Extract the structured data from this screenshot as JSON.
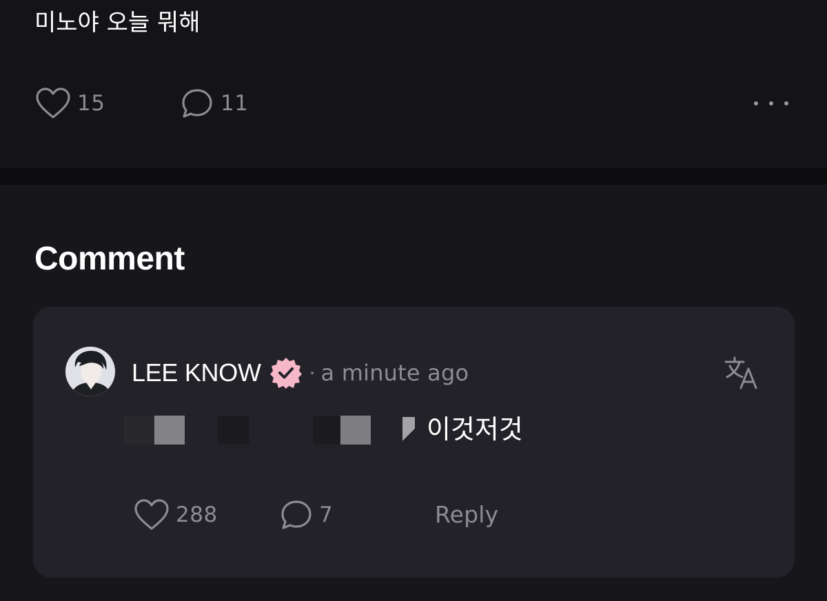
{
  "post": {
    "text": "미노야 오늘 뭐해",
    "like_count": "15",
    "comment_count": "11"
  },
  "comments_section": {
    "heading": "Comment"
  },
  "comment": {
    "author": "LEE KNOW",
    "separator": "·",
    "timestamp": "a minute ago",
    "text": "이것저것",
    "like_count": "288",
    "reply_count": "7",
    "reply_label": "Reply"
  },
  "colors": {
    "background": "#17161b",
    "post_background": "#141317",
    "card_background": "#232228",
    "muted_text": "#8d8c92",
    "verified_badge": "#f6b7c9"
  },
  "icons": {
    "like": "heart-outline-icon",
    "comment": "speech-bubble-icon",
    "more": "more-horizontal-icon",
    "verified": "verified-badge-icon",
    "translate": "translate-icon"
  }
}
